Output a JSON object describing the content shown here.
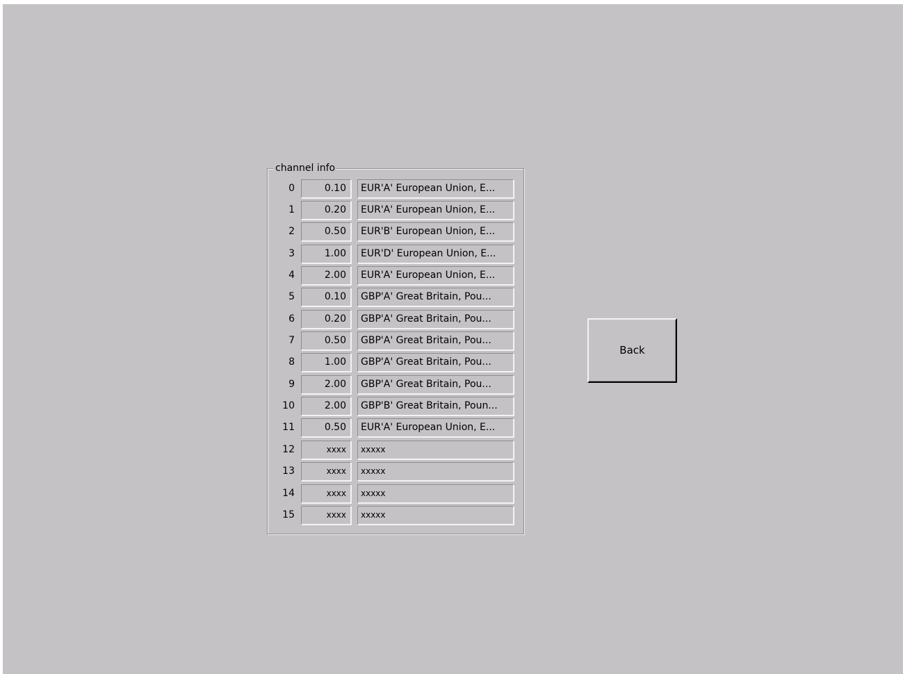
{
  "group": {
    "title": "channel info"
  },
  "channels": [
    {
      "index": "0",
      "value": "0.10",
      "description": "EUR'A' European Union, E..."
    },
    {
      "index": "1",
      "value": "0.20",
      "description": "EUR'A' European Union, E..."
    },
    {
      "index": "2",
      "value": "0.50",
      "description": "EUR'B' European Union, E..."
    },
    {
      "index": "3",
      "value": "1.00",
      "description": "EUR'D' European Union, E..."
    },
    {
      "index": "4",
      "value": "2.00",
      "description": "EUR'A' European Union, E..."
    },
    {
      "index": "5",
      "value": "0.10",
      "description": "GBP'A' Great Britain, Pou..."
    },
    {
      "index": "6",
      "value": "0.20",
      "description": "GBP'A' Great Britain, Pou..."
    },
    {
      "index": "7",
      "value": "0.50",
      "description": "GBP'A' Great Britain, Pou..."
    },
    {
      "index": "8",
      "value": "1.00",
      "description": "GBP'A' Great Britain, Pou..."
    },
    {
      "index": "9",
      "value": "2.00",
      "description": "GBP'A' Great Britain, Pou..."
    },
    {
      "index": "10",
      "value": "2.00",
      "description": "GBP'B' Great Britain, Poun..."
    },
    {
      "index": "11",
      "value": "0.50",
      "description": "EUR'A' European Union, E..."
    },
    {
      "index": "12",
      "value": "xxxx",
      "description": "xxxxx"
    },
    {
      "index": "13",
      "value": "xxxx",
      "description": "xxxxx"
    },
    {
      "index": "14",
      "value": "xxxx",
      "description": "xxxxx"
    },
    {
      "index": "15",
      "value": "xxxx",
      "description": "xxxxx"
    }
  ],
  "actions": {
    "back_label": "Back"
  }
}
